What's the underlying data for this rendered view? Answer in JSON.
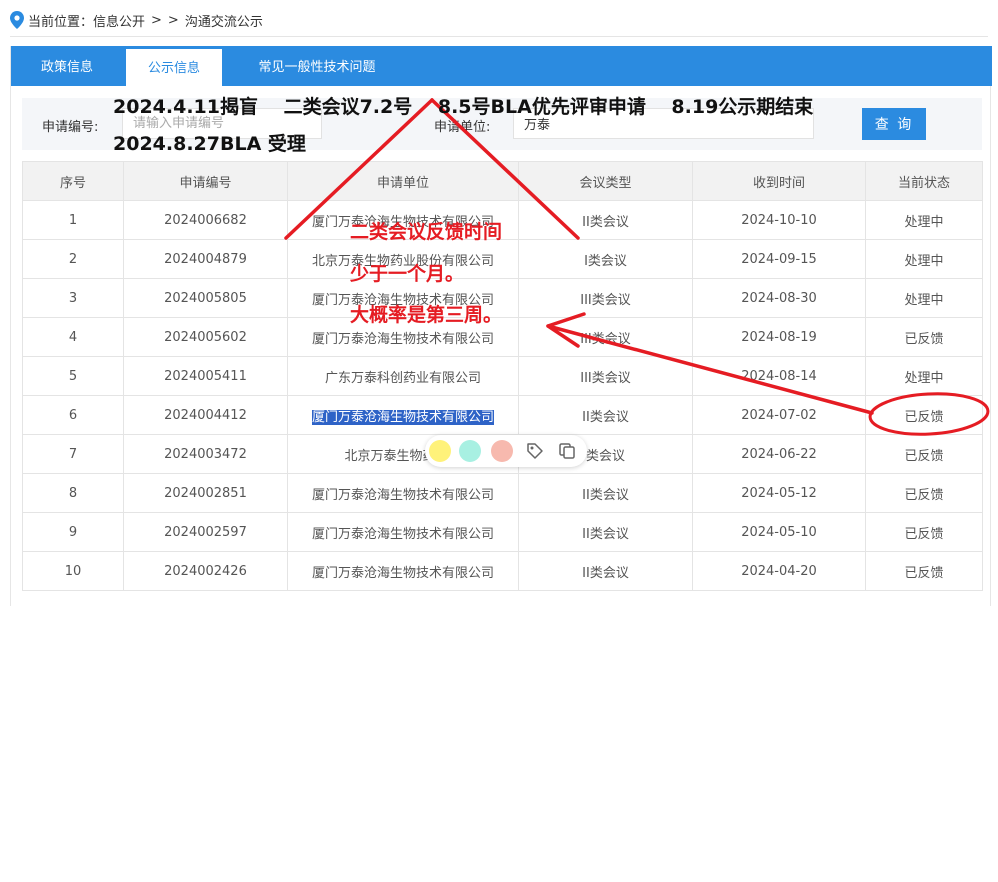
{
  "breadcrumb": {
    "prefix": "当前位置：信息公开",
    "sep1": ">",
    "sep2": ">",
    "current": "沟通交流公示"
  },
  "tabs": [
    {
      "label": "政策信息",
      "active": false
    },
    {
      "label": "公示信息",
      "active": true
    },
    {
      "label": "常见一般性技术问题",
      "active": false
    }
  ],
  "search": {
    "app_no_label": "申请编号:",
    "app_no_placeholder": "请输入申请编号",
    "unit_label": "申请单位:",
    "unit_value": "万泰",
    "query_button": "查 询"
  },
  "table": {
    "headers": [
      "序号",
      "申请编号",
      "申请单位",
      "会议类型",
      "收到时间",
      "当前状态"
    ],
    "rows": [
      [
        "1",
        "2024006682",
        "厦门万泰沧海生物技术有限公司",
        "II类会议",
        "2024-10-10",
        "处理中"
      ],
      [
        "2",
        "2024004879",
        "北京万泰生物药业股份有限公司",
        "I类会议",
        "2024-09-15",
        "处理中"
      ],
      [
        "3",
        "2024005805",
        "厦门万泰沧海生物技术有限公司",
        "III类会议",
        "2024-08-30",
        "处理中"
      ],
      [
        "4",
        "2024005602",
        "厦门万泰沧海生物技术有限公司",
        "III类会议",
        "2024-08-19",
        "已反馈"
      ],
      [
        "5",
        "2024005411",
        "广东万泰科创药业有限公司",
        "III类会议",
        "2024-08-14",
        "处理中"
      ],
      [
        "6",
        "2024004412",
        "厦门万泰沧海生物技术有限公司",
        "II类会议",
        "2024-07-02",
        "已反馈"
      ],
      [
        "7",
        "2024003472",
        "北京万泰生物药业股",
        "类会议",
        "2024-06-22",
        "已反馈"
      ],
      [
        "8",
        "2024002851",
        "厦门万泰沧海生物技术有限公司",
        "II类会议",
        "2024-05-12",
        "已反馈"
      ],
      [
        "9",
        "2024002597",
        "厦门万泰沧海生物技术有限公司",
        "II类会议",
        "2024-05-10",
        "已反馈"
      ],
      [
        "10",
        "2024002426",
        "厦门万泰沧海生物技术有限公司",
        "II类会议",
        "2024-04-20",
        "已反馈"
      ]
    ],
    "selected_row": 5
  },
  "highlight_toolbar": {
    "colors": [
      "#fff27a",
      "#a8f0e2",
      "#f7b9ae"
    ],
    "icons": [
      "tag-icon",
      "copy-icon"
    ]
  },
  "annotations": {
    "line1": "2024.4.11揭盲　 二类会议7.2号　 8.5号BLA优先评审申请　 8.19公示期结束",
    "line2": "2024.8.27BLA 受理",
    "note1": "二类会议反馈时间",
    "note2": "少于一个月。",
    "note3": "大概率是第三周。"
  },
  "colors": {
    "accent": "#2b8be0",
    "annotation_red": "#e51c23",
    "selection": "#2e63c7"
  }
}
